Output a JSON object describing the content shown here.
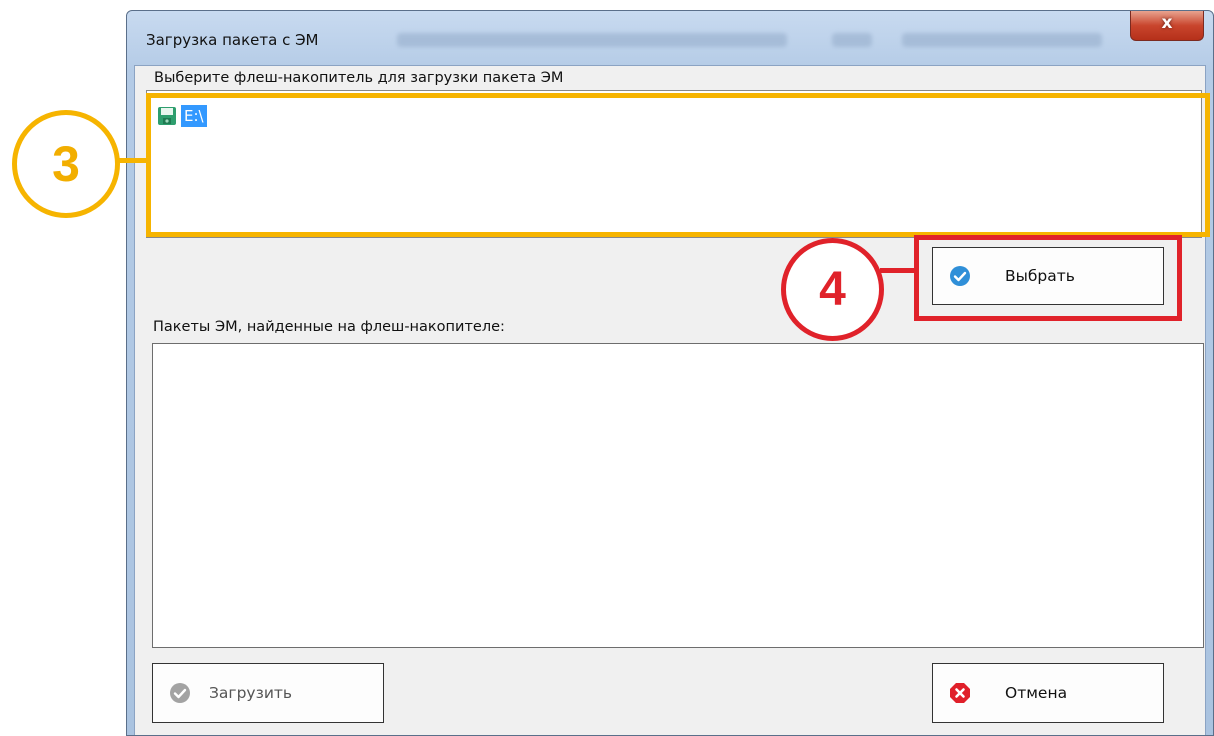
{
  "window": {
    "title": "Загрузка пакета с ЭМ",
    "close_label": "x"
  },
  "drive_section": {
    "label": "Выберите флеш-накопитель для загрузки пакета ЭМ",
    "drives": [
      {
        "label": "E:\\",
        "icon": "floppy-disk-icon",
        "selected": true
      }
    ]
  },
  "select_button": {
    "label": "Выбрать",
    "icon": "checkmark-circle-icon"
  },
  "packages_section": {
    "label": "Пакеты ЭМ, найденные на флеш-накопителе:",
    "items": []
  },
  "footer": {
    "load_button": {
      "label": "Загрузить",
      "icon": "checkmark-circle-icon",
      "enabled": false
    },
    "cancel_button": {
      "label": "Отмена",
      "icon": "close-circle-icon"
    }
  },
  "annotations": {
    "step_3": "3",
    "step_4": "4",
    "colors": {
      "step_3": "#f6b400",
      "step_4": "#e0222a"
    }
  }
}
